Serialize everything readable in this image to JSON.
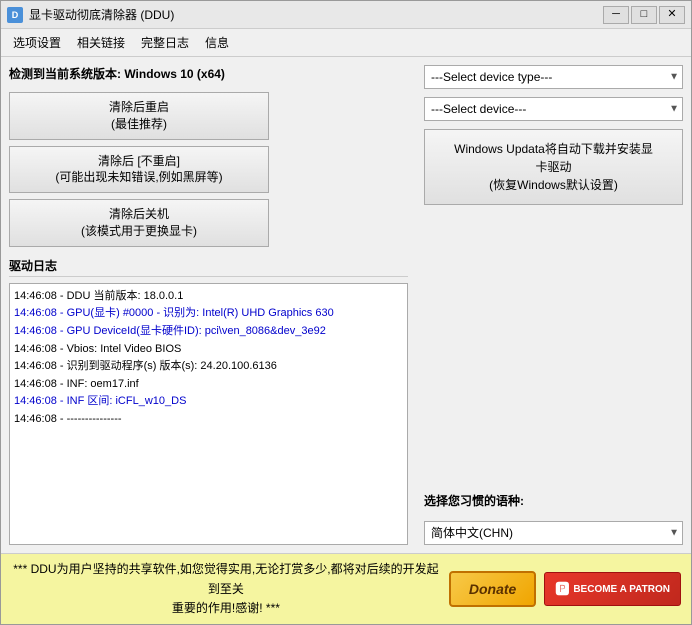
{
  "window": {
    "title": "显卡驱动彻底清除器 (DDU)",
    "icon": "D",
    "controls": {
      "minimize": "─",
      "maximize": "□",
      "close": "✕"
    }
  },
  "menu": {
    "items": [
      "选项设置",
      "相关链接",
      "完整日志",
      "信息"
    ]
  },
  "left": {
    "system_info": "检测到当前系统版本: Windows 10 (x64)",
    "buttons": [
      {
        "line1": "清除后重启",
        "line2": "(最佳推荐)"
      },
      {
        "line1": "清除后 [不重启]",
        "line2": "(可能出现未知错误,例如黑屏等)"
      },
      {
        "line1": "清除后关机",
        "line2": "(该模式用于更换显卡)"
      }
    ],
    "section_title": "驱动日志",
    "log_entries": [
      {
        "text": "14:46:08 - DDU 当前版本: 18.0.0.1",
        "color": "black"
      },
      {
        "text": "14:46:08 - GPU(显卡) #0000 - 识别为: Intel(R) UHD Graphics 630",
        "color": "blue"
      },
      {
        "text": "14:46:08 - GPU DeviceId(显卡硬件ID): pci\\ven_8086&dev_3e92",
        "color": "blue"
      },
      {
        "text": "14:46:08 - Vbios: Intel Video BIOS",
        "color": "black"
      },
      {
        "text": "14:46:08 - 识别到驱动程序(s) 版本(s): 24.20.100.6136",
        "color": "black"
      },
      {
        "text": "14:46:08 - INF: oem17.inf",
        "color": "black"
      },
      {
        "text": "14:46:08 - INF 区间: iCFL_w10_DS",
        "color": "blue"
      },
      {
        "text": "14:46:08 - ---------------",
        "color": "black"
      }
    ]
  },
  "right": {
    "device_type_placeholder": "---Select device type---",
    "device_placeholder": "---Select device---",
    "windows_update_btn": {
      "line1": "Windows Updata将自动下载并安装显",
      "line2": "卡驱动",
      "line3": "(恢复Windows默认设置)"
    },
    "language_label": "选择您习惯的语种:",
    "language_value": "简体中文(CHN)"
  },
  "footer": {
    "text_line1": "*** DDU为用户坚持的共享软件,如您觉得实用,无论打赏多少,都将对后续的开发起到至关",
    "text_line2": "重要的作用!感谢! ***",
    "donate_label": "Donate",
    "patron_label": "BECOME A PATRON",
    "patron_icon": "🅿"
  }
}
